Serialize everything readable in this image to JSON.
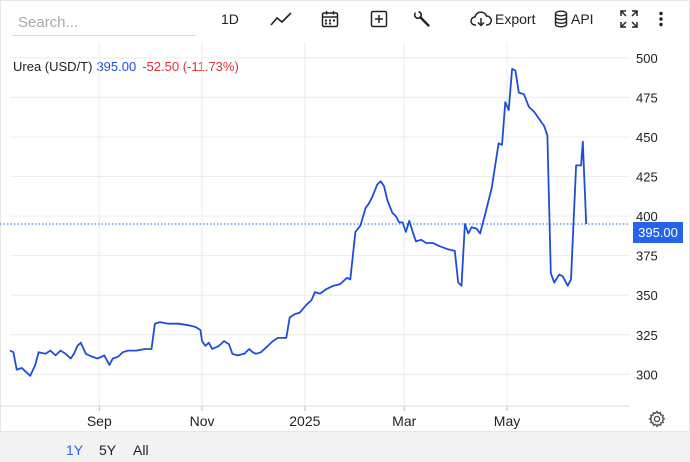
{
  "toolbar": {
    "search_placeholder": "Search...",
    "interval_label": "1D",
    "export_label": "Export",
    "api_label": "API",
    "icons": [
      "line-chart-icon",
      "calendar-icon",
      "plus-square-icon",
      "wrench-icon",
      "cloud-download-icon",
      "database-icon",
      "fullscreen-icon",
      "more-vertical-icon"
    ]
  },
  "header": {
    "instrument": "Urea (USD/T)",
    "last": "395.00",
    "change": "-52.50 (-11.73%)"
  },
  "bottom_bar": {
    "ranges": [
      "1Y",
      "5Y",
      "All"
    ],
    "active": "1Y"
  },
  "colors": {
    "line": "#1d4ed8",
    "accent": "#2563eb",
    "negative": "#e03131",
    "grid": "#ececec"
  },
  "chart_data": {
    "type": "line",
    "title": "Urea (USD/T)",
    "last_price_label": "395.00",
    "ylim": [
      280,
      510
    ],
    "yticks": [
      300,
      325,
      350,
      375,
      400,
      425,
      450,
      475,
      500
    ],
    "xlim": [
      "2024-07-10",
      "2025-07-13"
    ],
    "xticks": [
      {
        "date": "2024-09-01",
        "label": "Sep"
      },
      {
        "date": "2024-11-01",
        "label": "Nov"
      },
      {
        "date": "2025-01-01",
        "label": "2025"
      },
      {
        "date": "2025-03-01",
        "label": "Mar"
      },
      {
        "date": "2025-05-01",
        "label": "May"
      }
    ],
    "grid": true,
    "series": [
      {
        "points": [
          [
            "2024-07-10",
            315
          ],
          [
            "2024-07-12",
            314
          ],
          [
            "2024-07-14",
            303
          ],
          [
            "2024-07-17",
            304
          ],
          [
            "2024-07-19",
            302
          ],
          [
            "2024-07-22",
            299
          ],
          [
            "2024-07-25",
            306
          ],
          [
            "2024-07-27",
            314
          ],
          [
            "2024-07-31",
            313
          ],
          [
            "2024-08-03",
            315
          ],
          [
            "2024-08-06",
            312
          ],
          [
            "2024-08-09",
            315
          ],
          [
            "2024-08-12",
            313
          ],
          [
            "2024-08-15",
            310
          ],
          [
            "2024-08-17",
            313
          ],
          [
            "2024-08-19",
            318
          ],
          [
            "2024-08-21",
            320
          ],
          [
            "2024-08-24",
            313
          ],
          [
            "2024-08-28",
            311
          ],
          [
            "2024-08-31",
            310
          ],
          [
            "2024-09-04",
            312
          ],
          [
            "2024-09-07",
            306
          ],
          [
            "2024-09-09",
            310
          ],
          [
            "2024-09-12",
            311
          ],
          [
            "2024-09-15",
            314
          ],
          [
            "2024-09-18",
            315
          ],
          [
            "2024-09-23",
            315
          ],
          [
            "2024-09-28",
            316
          ],
          [
            "2024-10-02",
            316
          ],
          [
            "2024-10-04",
            332
          ],
          [
            "2024-10-07",
            333
          ],
          [
            "2024-10-12",
            332
          ],
          [
            "2024-10-18",
            332
          ],
          [
            "2024-10-24",
            331
          ],
          [
            "2024-10-28",
            330
          ],
          [
            "2024-10-31",
            328
          ],
          [
            "2024-11-01",
            321
          ],
          [
            "2024-11-03",
            318
          ],
          [
            "2024-11-05",
            320
          ],
          [
            "2024-11-07",
            316
          ],
          [
            "2024-11-09",
            317
          ],
          [
            "2024-11-11",
            318
          ],
          [
            "2024-11-14",
            321
          ],
          [
            "2024-11-17",
            319
          ],
          [
            "2024-11-19",
            313
          ],
          [
            "2024-11-22",
            312
          ],
          [
            "2024-11-26",
            313
          ],
          [
            "2024-11-29",
            316
          ],
          [
            "2024-12-01",
            314
          ],
          [
            "2024-12-03",
            313
          ],
          [
            "2024-12-06",
            314
          ],
          [
            "2024-12-10",
            318
          ],
          [
            "2024-12-13",
            321
          ],
          [
            "2024-12-16",
            323
          ],
          [
            "2024-12-21",
            323
          ],
          [
            "2024-12-23",
            336
          ],
          [
            "2024-12-26",
            338
          ],
          [
            "2024-12-29",
            339
          ],
          [
            "2025-01-02",
            344
          ],
          [
            "2025-01-05",
            347
          ],
          [
            "2025-01-07",
            352
          ],
          [
            "2025-01-10",
            351
          ],
          [
            "2025-01-14",
            354
          ],
          [
            "2025-01-18",
            356
          ],
          [
            "2025-01-22",
            357
          ],
          [
            "2025-01-26",
            361
          ],
          [
            "2025-01-28",
            360
          ],
          [
            "2025-01-31",
            390
          ],
          [
            "2025-02-03",
            394
          ],
          [
            "2025-02-06",
            405
          ],
          [
            "2025-02-08",
            408
          ],
          [
            "2025-02-10",
            412
          ],
          [
            "2025-02-13",
            420
          ],
          [
            "2025-02-15",
            422
          ],
          [
            "2025-02-17",
            419
          ],
          [
            "2025-02-19",
            410
          ],
          [
            "2025-02-22",
            402
          ],
          [
            "2025-02-24",
            400
          ],
          [
            "2025-02-26",
            396
          ],
          [
            "2025-02-28",
            396
          ],
          [
            "2025-03-02",
            390
          ],
          [
            "2025-03-04",
            397
          ],
          [
            "2025-03-06",
            390
          ],
          [
            "2025-03-08",
            384
          ],
          [
            "2025-03-11",
            385
          ],
          [
            "2025-03-14",
            383
          ],
          [
            "2025-03-18",
            383
          ],
          [
            "2025-03-22",
            381
          ],
          [
            "2025-03-27",
            379
          ],
          [
            "2025-03-31",
            378
          ],
          [
            "2025-04-02",
            358
          ],
          [
            "2025-04-04",
            356
          ],
          [
            "2025-04-06",
            395
          ],
          [
            "2025-04-08",
            389
          ],
          [
            "2025-04-10",
            393
          ],
          [
            "2025-04-13",
            392
          ],
          [
            "2025-04-15",
            389
          ],
          [
            "2025-04-18",
            401
          ],
          [
            "2025-04-22",
            418
          ],
          [
            "2025-04-26",
            446
          ],
          [
            "2025-04-28",
            445
          ],
          [
            "2025-04-30",
            472
          ],
          [
            "2025-05-02",
            467
          ],
          [
            "2025-05-04",
            493
          ],
          [
            "2025-05-06",
            492
          ],
          [
            "2025-05-08",
            478
          ],
          [
            "2025-05-11",
            477
          ],
          [
            "2025-05-14",
            469
          ],
          [
            "2025-05-17",
            466
          ],
          [
            "2025-05-21",
            460
          ],
          [
            "2025-05-23",
            457
          ],
          [
            "2025-05-25",
            451
          ],
          [
            "2025-05-27",
            364
          ],
          [
            "2025-05-29",
            358
          ],
          [
            "2025-06-01",
            363
          ],
          [
            "2025-06-03",
            362
          ],
          [
            "2025-06-06",
            356
          ],
          [
            "2025-06-08",
            360
          ],
          [
            "2025-06-11",
            432
          ],
          [
            "2025-06-14",
            432
          ],
          [
            "2025-06-15",
            447
          ],
          [
            "2025-06-17",
            395
          ]
        ]
      }
    ]
  }
}
